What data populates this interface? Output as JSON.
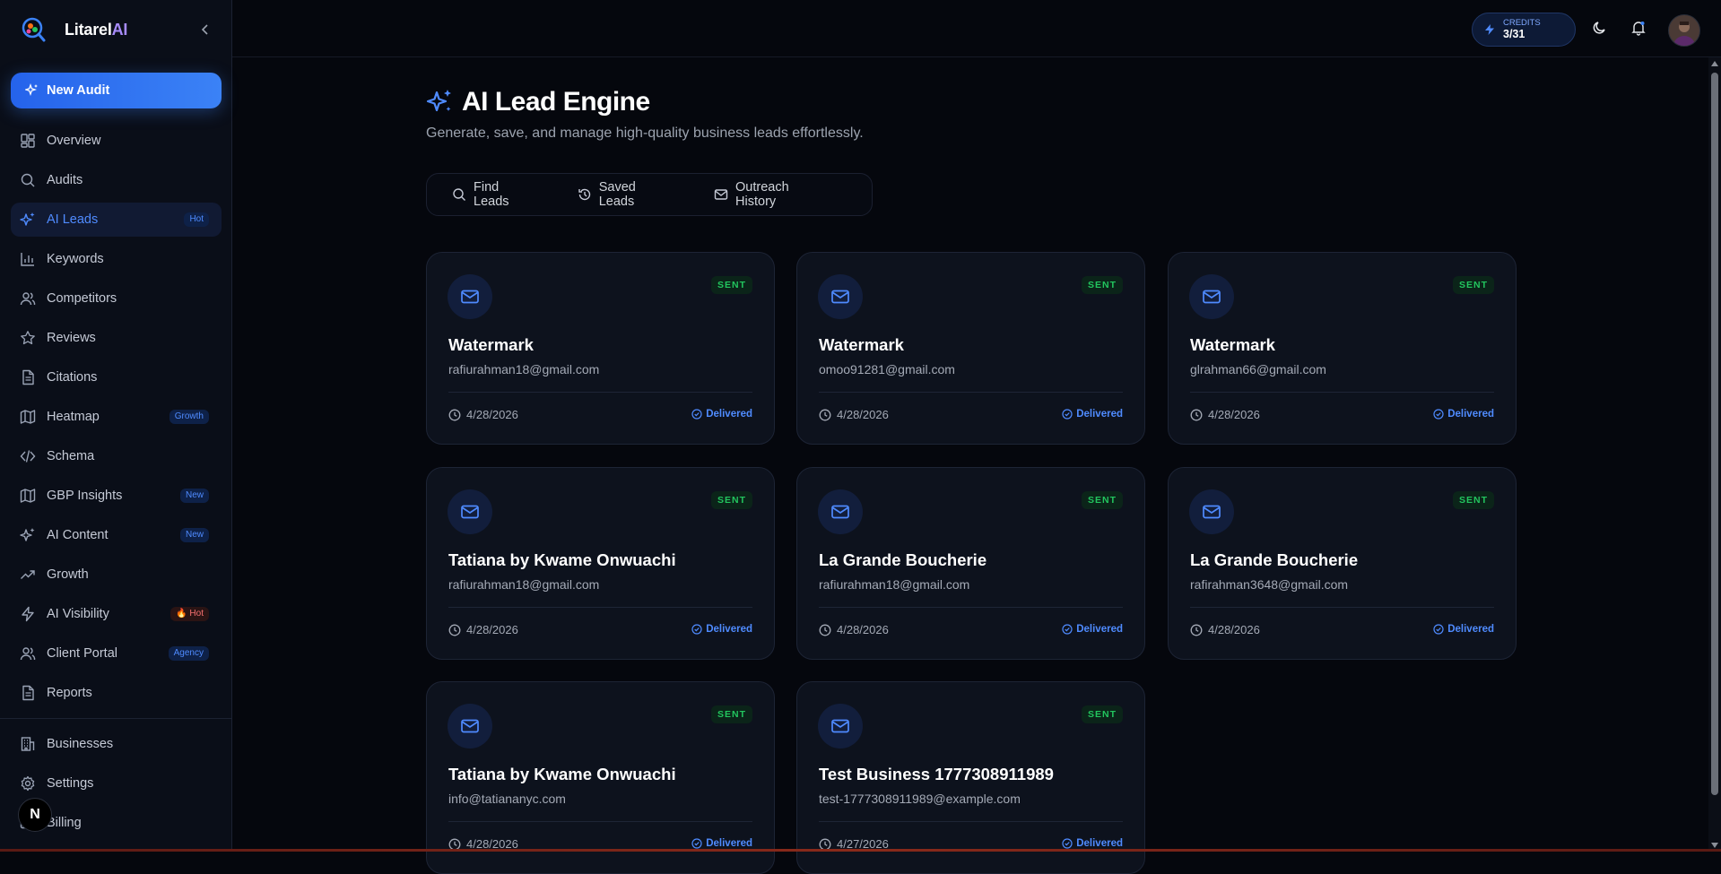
{
  "brand": {
    "name_main": "Litarel",
    "name_ai": "AI"
  },
  "sidebar": {
    "new_audit": "New Audit",
    "items": [
      {
        "label": "Overview",
        "icon": "grid-icon"
      },
      {
        "label": "Audits",
        "icon": "search-icon"
      },
      {
        "label": "AI Leads",
        "icon": "sparkles-icon",
        "badge": "Hot",
        "active": true
      },
      {
        "label": "Keywords",
        "icon": "bar-chart-icon"
      },
      {
        "label": "Competitors",
        "icon": "users-icon"
      },
      {
        "label": "Reviews",
        "icon": "star-icon"
      },
      {
        "label": "Citations",
        "icon": "document-icon"
      },
      {
        "label": "Heatmap",
        "icon": "map-icon",
        "badge": "Growth"
      },
      {
        "label": "Schema",
        "icon": "code-icon"
      },
      {
        "label": "GBP Insights",
        "icon": "map-icon",
        "badge": "New"
      },
      {
        "label": "AI Content",
        "icon": "sparkles-icon",
        "badge": "New"
      },
      {
        "label": "Growth",
        "icon": "trending-up-icon"
      },
      {
        "label": "AI Visibility",
        "icon": "bolt-icon",
        "badge": "🔥 Hot"
      },
      {
        "label": "Client Portal",
        "icon": "users-icon",
        "badge": "Agency"
      },
      {
        "label": "Reports",
        "icon": "document-icon"
      }
    ],
    "bottom_items": [
      {
        "label": "Businesses",
        "icon": "building-icon"
      },
      {
        "label": "Settings",
        "icon": "gear-icon"
      },
      {
        "label": "Billing",
        "icon": "card-icon"
      }
    ],
    "n_bubble": "N"
  },
  "topbar": {
    "credits_label": "CREDITS",
    "credits_value": "3/31"
  },
  "page": {
    "title": "AI Lead Engine",
    "subtitle": "Generate, save, and manage high-quality business leads effortlessly."
  },
  "tabs": [
    "Find Leads",
    "Saved Leads",
    "Outreach History"
  ],
  "cards": [
    {
      "name": "Watermark",
      "email": "rafiurahman18@gmail.com",
      "date": "4/28/2026",
      "badge": "SENT",
      "status": "Delivered"
    },
    {
      "name": "Watermark",
      "email": "omoo91281@gmail.com",
      "date": "4/28/2026",
      "badge": "SENT",
      "status": "Delivered"
    },
    {
      "name": "Watermark",
      "email": "glrahman66@gmail.com",
      "date": "4/28/2026",
      "badge": "SENT",
      "status": "Delivered"
    },
    {
      "name": "Tatiana by Kwame Onwuachi",
      "email": "rafiurahman18@gmail.com",
      "date": "4/28/2026",
      "badge": "SENT",
      "status": "Delivered"
    },
    {
      "name": "La Grande Boucherie",
      "email": "rafiurahman18@gmail.com",
      "date": "4/28/2026",
      "badge": "SENT",
      "status": "Delivered"
    },
    {
      "name": "La Grande Boucherie",
      "email": "rafirahman3648@gmail.com",
      "date": "4/28/2026",
      "badge": "SENT",
      "status": "Delivered"
    },
    {
      "name": "Tatiana by Kwame Onwuachi",
      "email": "info@tatiananyc.com",
      "date": "4/28/2026",
      "badge": "SENT",
      "status": "Delivered"
    },
    {
      "name": "Test Business 1777308911989",
      "email": "test-1777308911989@example.com",
      "date": "4/27/2026",
      "badge": "SENT",
      "status": "Delivered"
    }
  ],
  "colors": {
    "accent": "#4f8bff",
    "sent_green": "#22c55e",
    "background": "#05070d",
    "sidebar": "#0a0e18",
    "card": "#0d121d"
  }
}
